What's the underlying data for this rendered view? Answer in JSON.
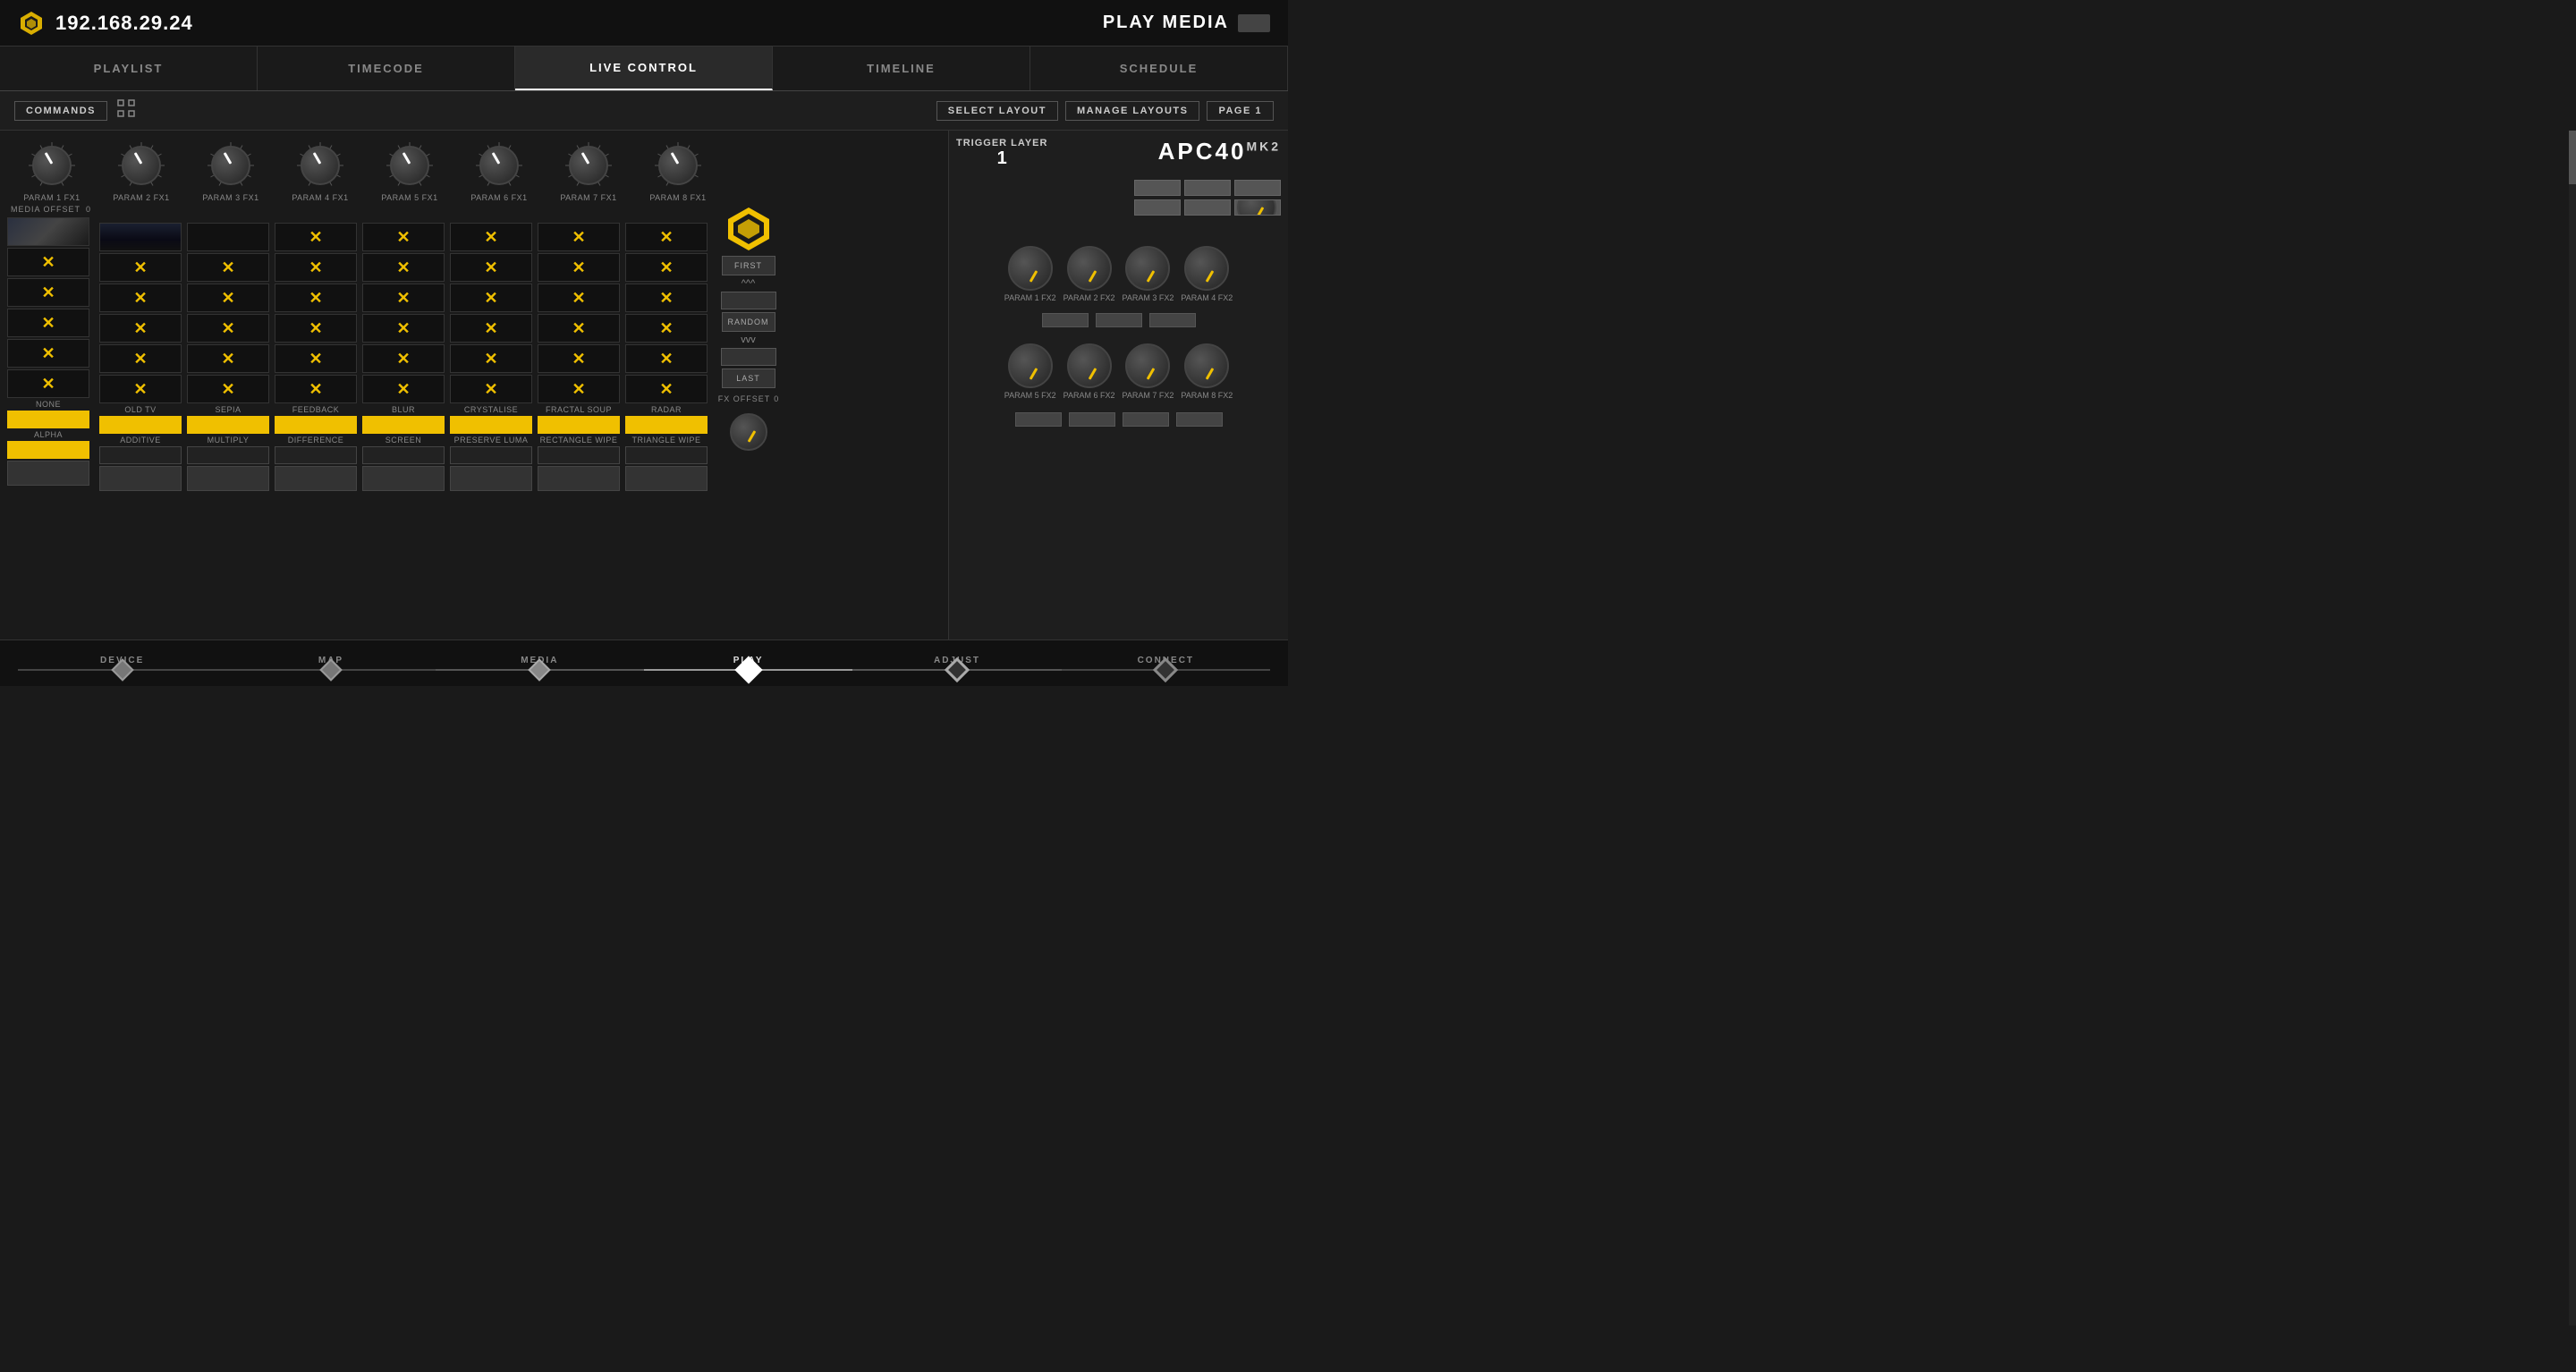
{
  "topbar": {
    "ip": "192.168.29.24",
    "play_media_label": "PLAY MEDIA"
  },
  "nav": {
    "tabs": [
      "PLAYLIST",
      "TIMECODE",
      "LIVE CONTROL",
      "TIMELINE",
      "SCHEDULE"
    ],
    "active": 2
  },
  "toolbar": {
    "commands_label": "COMMANDS",
    "select_layout_label": "SELECT LAYOUT",
    "manage_layouts_label": "MANAGE LAYOUTS",
    "page_label": "PAGE 1"
  },
  "knobs": {
    "fx1_labels": [
      "PARAM 1 FX1",
      "PARAM 2 FX1",
      "PARAM 3 FX1",
      "PARAM 4 FX1",
      "PARAM 5 FX1",
      "PARAM 6 FX1",
      "PARAM 7 FX1",
      "PARAM 8 FX1"
    ],
    "media_offset_label": "MEDIA OFFSET",
    "media_offset_val": "0"
  },
  "playhead": {
    "first_label": "FIRST",
    "up_label": "^^^",
    "random_label": "RANDOM",
    "down_label": "vvv",
    "last_label": "LAST",
    "fx_offset_label": "FX OFFSET",
    "fx_offset_val": "0"
  },
  "fx_labels": [
    "NONE",
    "OLD TV",
    "SEPIA",
    "FEEDBACK",
    "BLUR",
    "CRYSTALISE",
    "FRACTAL SOUP",
    "RADAR"
  ],
  "blend_labels": [
    "ALPHA",
    "ADDITIVE",
    "MULTIPLY",
    "DIFFERENCE",
    "SCREEN",
    "PRESERVE LUMA",
    "RECTANGLE WIPE",
    "TRIANGLE WIPE"
  ],
  "right_panel": {
    "trigger_layer_label": "TRIGGER LAYER",
    "trigger_layer_num": "1",
    "apc40_label": "APC40",
    "apc40_suffix": "MK2",
    "fx2_labels": [
      "PARAM 1 FX2",
      "PARAM 2 FX2",
      "PARAM 3 FX2",
      "PARAM 4 FX2",
      "PARAM 5 FX2",
      "PARAM 6 FX2",
      "PARAM 7 FX2",
      "PARAM 8 FX2"
    ]
  },
  "bottom_nav": {
    "steps": [
      "DEVICE",
      "MAP",
      "MEDIA",
      "PLAY",
      "ADJUST",
      "CONNECT"
    ],
    "active": 3
  }
}
